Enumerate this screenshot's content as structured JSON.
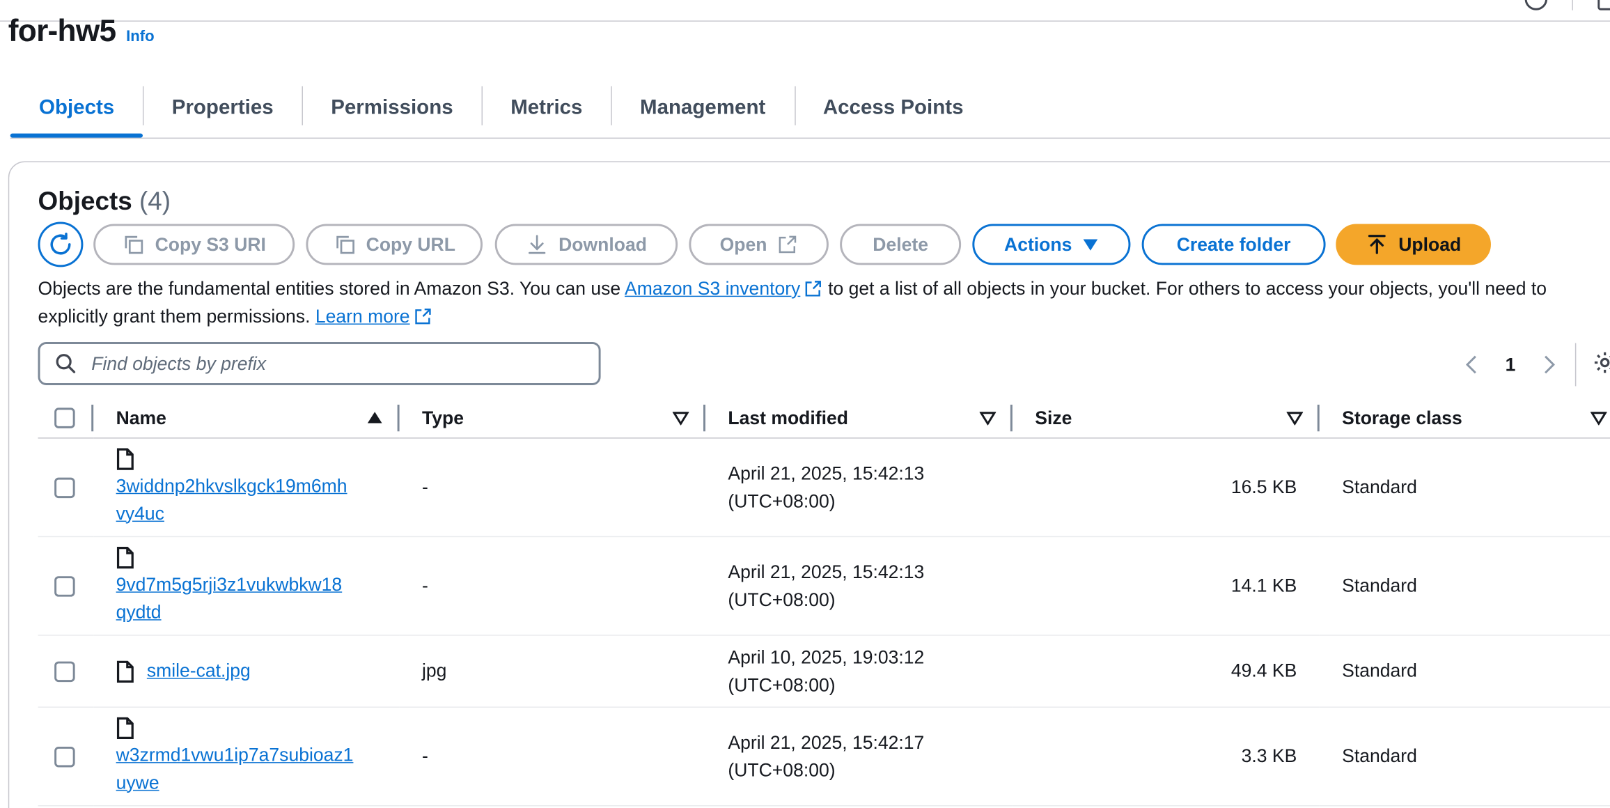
{
  "bucket": {
    "name": "for-hw5",
    "info_label": "Info"
  },
  "tabs": [
    {
      "label": "Objects",
      "active": true
    },
    {
      "label": "Properties"
    },
    {
      "label": "Permissions"
    },
    {
      "label": "Metrics"
    },
    {
      "label": "Management"
    },
    {
      "label": "Access Points"
    }
  ],
  "objects_section": {
    "title": "Objects",
    "count": "(4)"
  },
  "toolbar": {
    "copy_s3_uri": "Copy S3 URI",
    "copy_url": "Copy URL",
    "download": "Download",
    "open": "Open",
    "delete": "Delete",
    "actions": "Actions",
    "create_folder": "Create folder",
    "upload": "Upload"
  },
  "description": {
    "part1": "Objects are the fundamental entities stored in Amazon S3. You can use ",
    "inventory_link": "Amazon S3 inventory",
    "part2": " to get a list of all objects in your bucket. For others to access your objects, you'll need to explicitly grant them permissions. ",
    "learn_more": "Learn more"
  },
  "search": {
    "placeholder": "Find objects by prefix",
    "value": ""
  },
  "pagination": {
    "current_page": "1"
  },
  "table": {
    "headers": {
      "name": "Name",
      "type": "Type",
      "last_modified": "Last modified",
      "size": "Size",
      "storage_class": "Storage class"
    },
    "rows": [
      {
        "name_line1": "3widdnp2hkvslkgck19m6mh",
        "name_line2": "vy4uc",
        "type": "-",
        "modified_date": "April 21, 2025, 15:42:13",
        "modified_tz": "(UTC+08:00)",
        "size": "16.5 KB",
        "storage_class": "Standard"
      },
      {
        "name_line1": "9vd7m5g5rji3z1vukwbkw18",
        "name_line2": "qydtd",
        "type": "-",
        "modified_date": "April 21, 2025, 15:42:13",
        "modified_tz": "(UTC+08:00)",
        "size": "14.1 KB",
        "storage_class": "Standard"
      },
      {
        "name": "smile-cat.jpg",
        "type": "jpg",
        "modified_date": "April 10, 2025, 19:03:12",
        "modified_tz": "(UTC+08:00)",
        "size": "49.4 KB",
        "storage_class": "Standard"
      },
      {
        "name_line1": "w3zrmd1vwu1ip7a7subioaz1",
        "name_line2": "uywe",
        "type": "-",
        "modified_date": "April 21, 2025, 15:42:17",
        "modified_tz": "(UTC+08:00)",
        "size": "3.3 KB",
        "storage_class": "Standard"
      }
    ]
  },
  "colors": {
    "accent": "#0972d3",
    "upload": "#f4a62a",
    "border": "#c6c6cd",
    "disabled": "#8d99a8"
  },
  "icons": [
    "refresh-icon",
    "copy-icon",
    "download-icon",
    "external-link-icon",
    "caret-down-icon",
    "upload-icon",
    "search-icon",
    "chevron-left-icon",
    "chevron-right-icon",
    "gear-icon",
    "file-icon",
    "sort-ascending-icon",
    "sort-icon"
  ]
}
